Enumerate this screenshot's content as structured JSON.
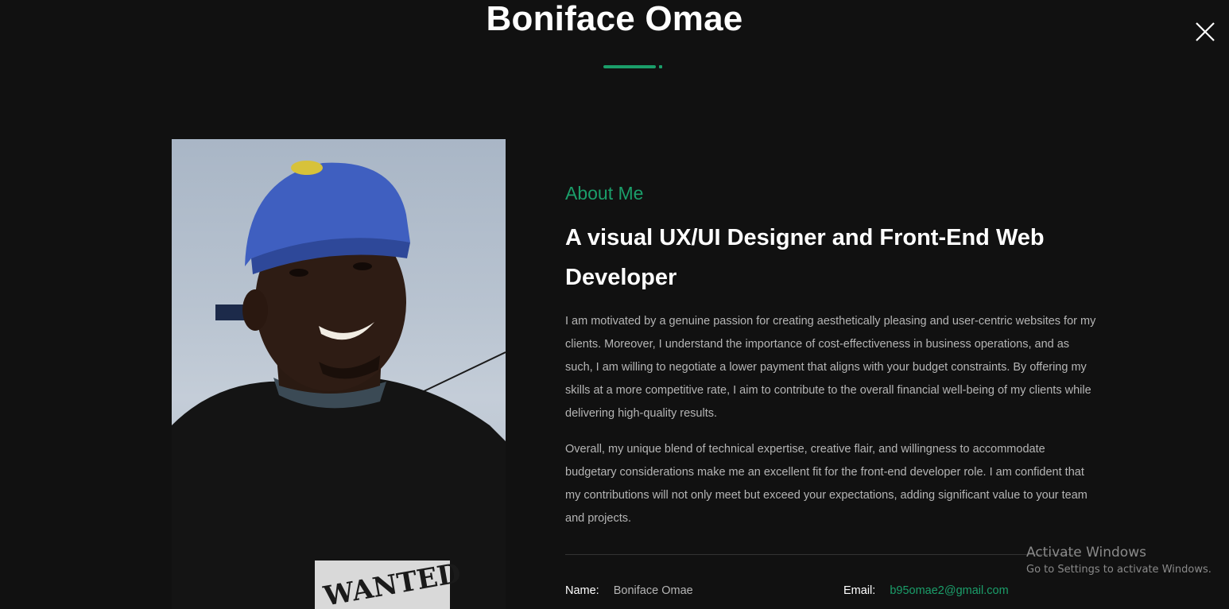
{
  "header": {
    "title": "Boniface Omae",
    "accent_color": "#1b9e6a",
    "close_icon": "close-icon"
  },
  "profile": {
    "photo_alt": "portrait-photo"
  },
  "about": {
    "label": "About Me",
    "headline": "A visual UX/UI Designer and Front-End Web Developer",
    "paragraph_1": "I am motivated by a genuine passion for creating aesthetically pleasing and user-centric websites for my clients. Moreover, I understand the importance of cost-effectiveness in business operations, and as such, I am willing to negotiate a lower payment that aligns with your budget constraints. By offering my skills at a more competitive rate, I aim to contribute to the overall financial well-being of my clients while delivering high-quality results.",
    "paragraph_2": "Overall, my unique blend of technical expertise, creative flair, and willingness to accommodate budgetary considerations make me an excellent fit for the front-end developer role. I am confident that my contributions will not only meet but exceed your expectations, adding significant value to your team and projects."
  },
  "info": {
    "name_label": "Name:",
    "name_value": "Boniface Omae",
    "email_label": "Email:",
    "email_value": "b95omae2@gmail.com"
  },
  "watermark": {
    "line1": "Activate Windows",
    "line2": "Go to Settings to activate Windows."
  }
}
